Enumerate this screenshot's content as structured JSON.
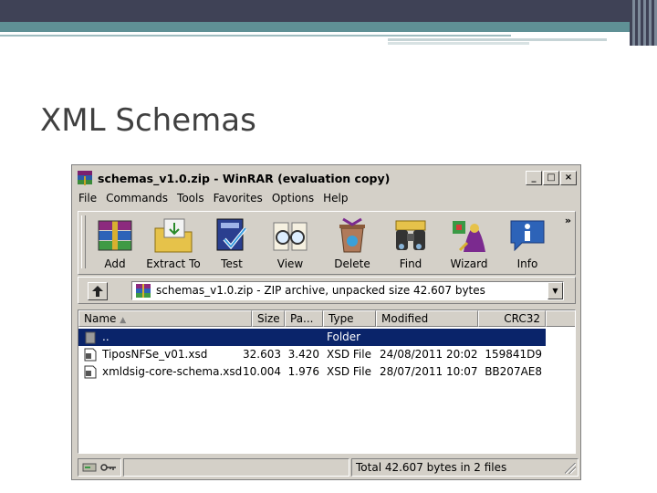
{
  "slide": {
    "title": "XML Schemas"
  },
  "window": {
    "title": "schemas_v1.0.zip - WinRAR (evaluation copy)",
    "controls": {
      "minimize": "_",
      "maximize": "□",
      "close": "×"
    }
  },
  "menu": [
    "File",
    "Commands",
    "Tools",
    "Favorites",
    "Options",
    "Help"
  ],
  "toolbar": {
    "buttons": [
      {
        "label": "Add",
        "icon": "add-archive-icon"
      },
      {
        "label": "Extract To",
        "icon": "extract-folder-icon"
      },
      {
        "label": "Test",
        "icon": "test-checkmark-icon"
      },
      {
        "label": "View",
        "icon": "view-glasses-icon"
      },
      {
        "label": "Delete",
        "icon": "delete-bin-icon"
      },
      {
        "label": "Find",
        "icon": "find-binoculars-icon"
      },
      {
        "label": "Wizard",
        "icon": "wizard-icon"
      },
      {
        "label": "Info",
        "icon": "info-icon"
      }
    ],
    "more": "»"
  },
  "address": {
    "text": "schemas_v1.0.zip - ZIP archive, unpacked size 42.607 bytes"
  },
  "filelist": {
    "columns": [
      "Name",
      "Size",
      "Pa...",
      "Type",
      "Modified",
      "CRC32"
    ],
    "rows": [
      {
        "name": "..",
        "size": "",
        "packed": "",
        "type": "Folder",
        "modified": "",
        "crc": "",
        "selected": true
      },
      {
        "name": "TiposNFSe_v01.xsd",
        "size": "32.603",
        "packed": "3.420",
        "type": "XSD File",
        "modified": "24/08/2011 20:02",
        "crc": "159841D9",
        "selected": false
      },
      {
        "name": "xmldsig-core-schema.xsd",
        "size": "10.004",
        "packed": "1.976",
        "type": "XSD File",
        "modified": "28/07/2011 10:07",
        "crc": "BB207AE8",
        "selected": false
      }
    ]
  },
  "status": {
    "text": "Total 42.607 bytes in 2 files"
  },
  "colors": {
    "selection": "#0a246a",
    "window_face": "#d4d0c8",
    "slide_band": "#3f4256",
    "slide_teal": "#5f9095"
  }
}
